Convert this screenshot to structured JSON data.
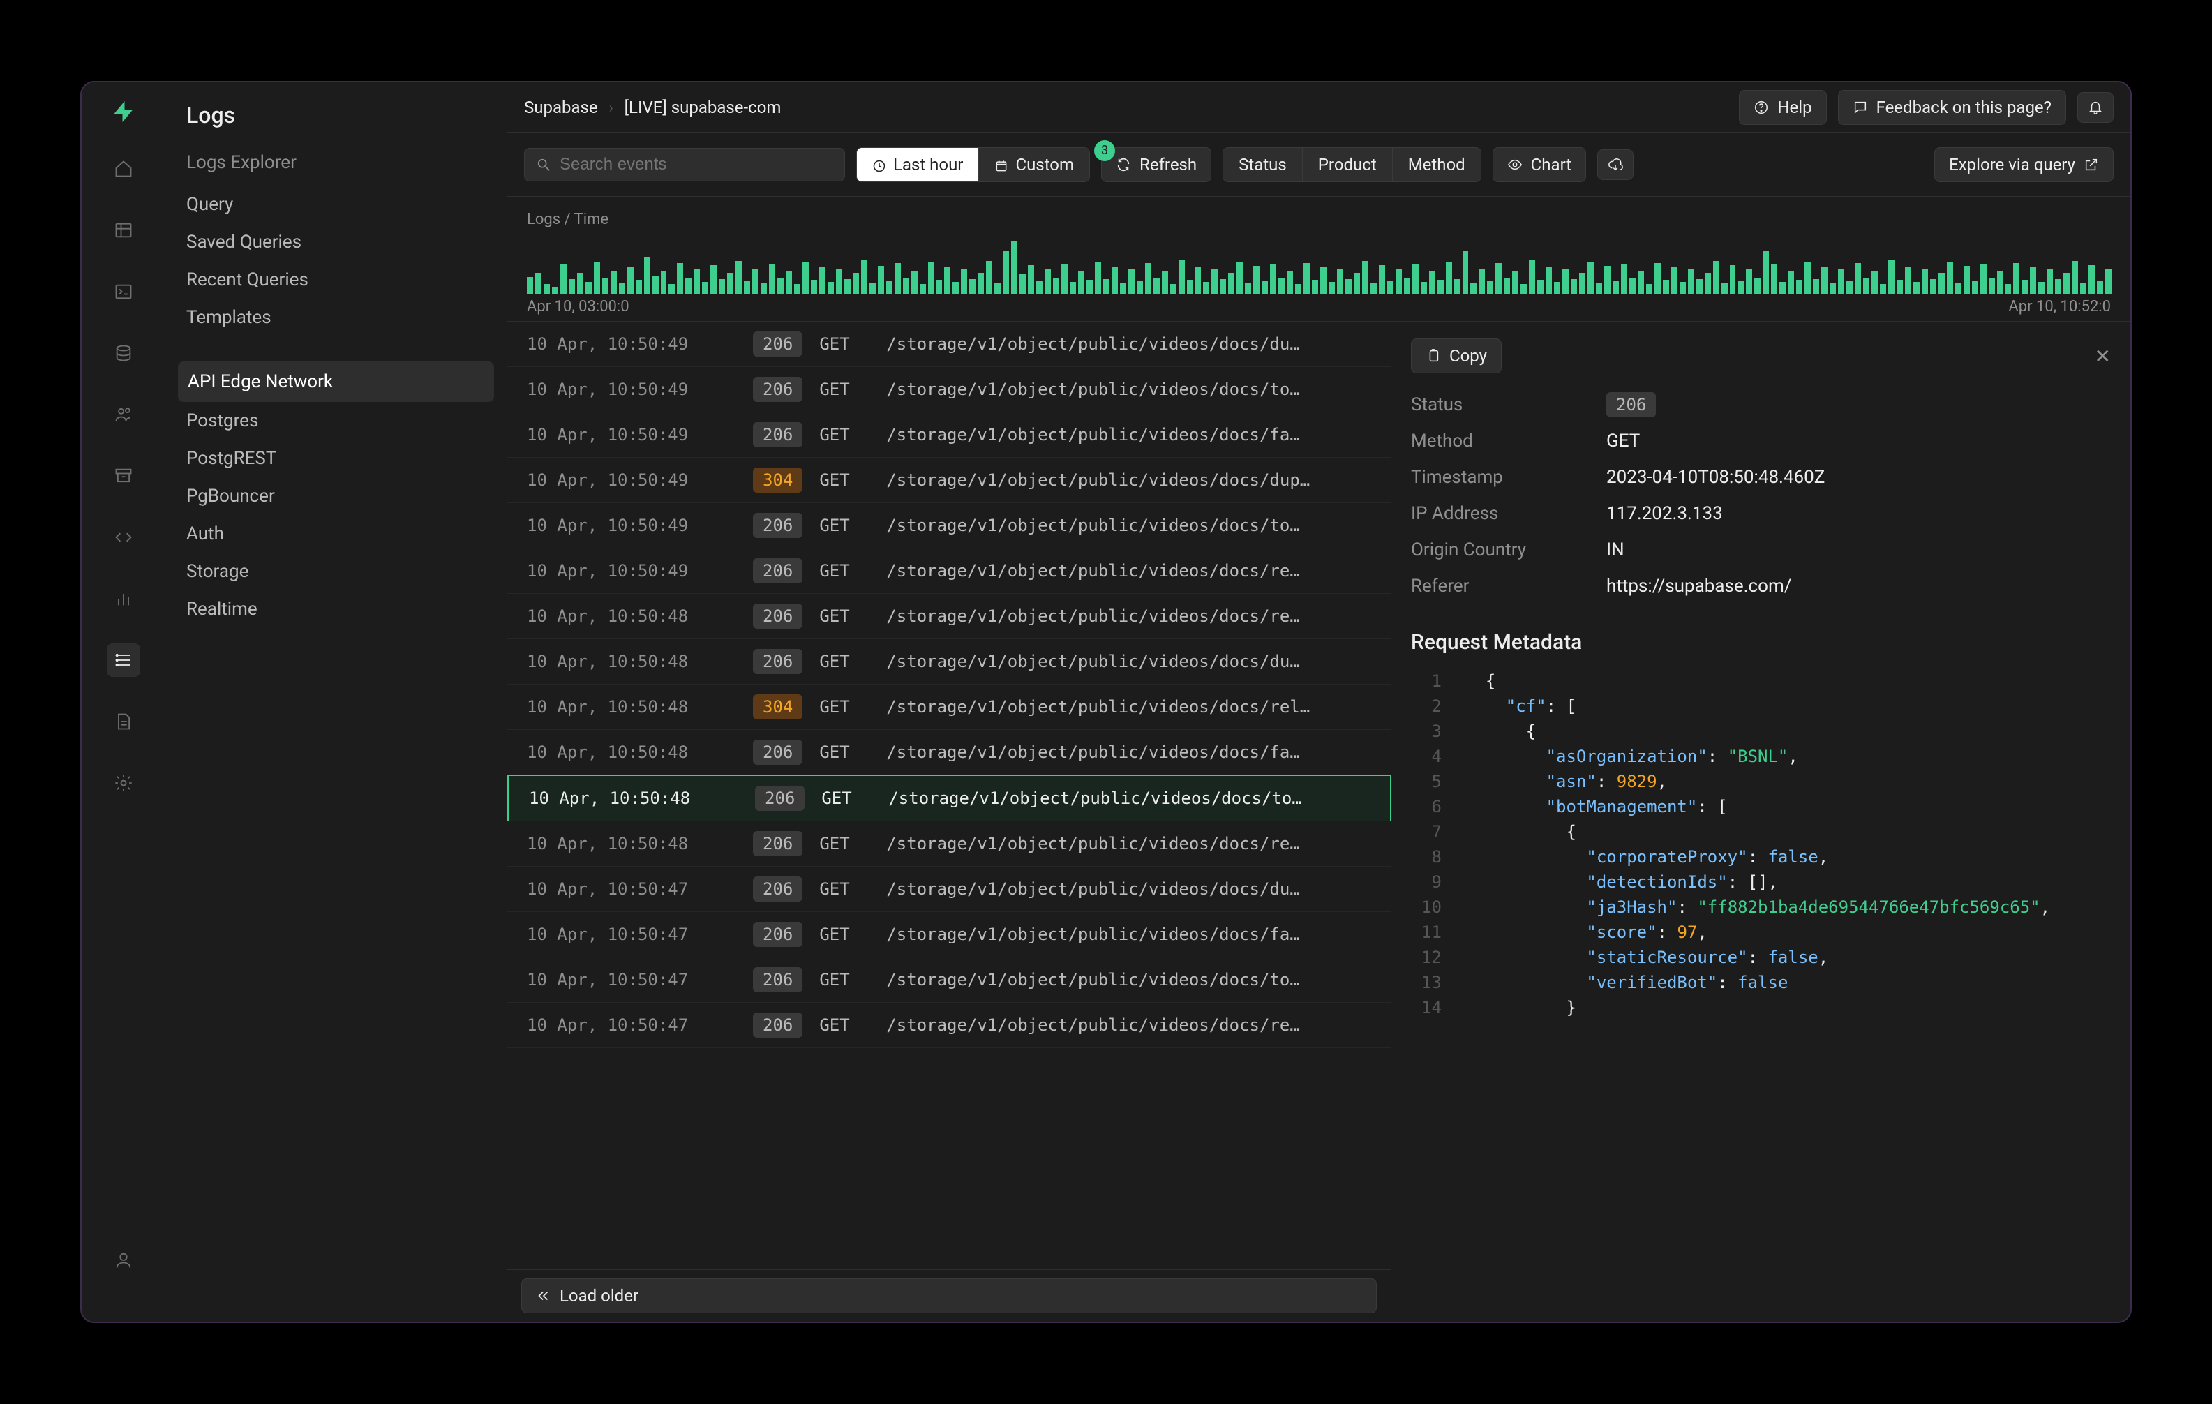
{
  "brand": {
    "accent": "#3ecf8e"
  },
  "topbar": {
    "crumb1": "Supabase",
    "crumb2": "[LIVE] supabase-com",
    "help": "Help",
    "feedback": "Feedback on this page?"
  },
  "subnav": {
    "title": "Logs",
    "section1_label": "Logs Explorer",
    "items1": [
      {
        "label": "Query"
      },
      {
        "label": "Saved Queries"
      },
      {
        "label": "Recent Queries"
      },
      {
        "label": "Templates"
      }
    ],
    "items2": [
      {
        "label": "API Edge Network",
        "active": true
      },
      {
        "label": "Postgres"
      },
      {
        "label": "PostgREST"
      },
      {
        "label": "PgBouncer"
      },
      {
        "label": "Auth"
      },
      {
        "label": "Storage"
      },
      {
        "label": "Realtime"
      }
    ]
  },
  "toolbar": {
    "search_placeholder": "Search events",
    "last_hour": "Last hour",
    "custom": "Custom",
    "refresh": "Refresh",
    "refresh_badge": "3",
    "status": "Status",
    "product": "Product",
    "method": "Method",
    "chart": "Chart",
    "explore": "Explore via query"
  },
  "chart": {
    "label": "Logs / Time",
    "axis_start": "Apr 10, 03:00:0",
    "axis_end": "Apr 10, 10:52:0"
  },
  "chart_data": {
    "type": "bar",
    "title": "Logs / Time",
    "xlabel": "",
    "ylabel": "",
    "categories": [
      "Apr 10, 03:00:0",
      "Apr 10, 10:52:0"
    ],
    "values": [
      32,
      40,
      18,
      12,
      55,
      28,
      40,
      22,
      60,
      30,
      44,
      20,
      50,
      26,
      70,
      34,
      42,
      18,
      58,
      30,
      46,
      22,
      54,
      28,
      40,
      62,
      24,
      48,
      20,
      56,
      30,
      44,
      18,
      60,
      26,
      50,
      22,
      46,
      28,
      40,
      64,
      20,
      52,
      24,
      58,
      30,
      44,
      18,
      60,
      26,
      50,
      22,
      46,
      28,
      40,
      62,
      20,
      80,
      100,
      38,
      54,
      24,
      48,
      30,
      56,
      22,
      44,
      26,
      60,
      28,
      50,
      20,
      46,
      24,
      58,
      30,
      42,
      18,
      64,
      26,
      50,
      22,
      46,
      28,
      40,
      60,
      20,
      52,
      24,
      56,
      30,
      44,
      18,
      58,
      26,
      50,
      22,
      46,
      28,
      40,
      62,
      20,
      54,
      24,
      48,
      30,
      56,
      22,
      44,
      26,
      60,
      28,
      82,
      20,
      46,
      24,
      58,
      30,
      42,
      18,
      64,
      26,
      50,
      22,
      46,
      28,
      40,
      60,
      20,
      52,
      24,
      56,
      30,
      44,
      18,
      58,
      26,
      50,
      22,
      46,
      28,
      40,
      62,
      20,
      54,
      24,
      48,
      30,
      80,
      56,
      22,
      44,
      26,
      60,
      28,
      50,
      20,
      46,
      24,
      58,
      30,
      42,
      18,
      64,
      26,
      50,
      22,
      46,
      28,
      40,
      60,
      20,
      52,
      24,
      56,
      30,
      44,
      18,
      58,
      26,
      50,
      22,
      46,
      28,
      40,
      62,
      20,
      54,
      24,
      48
    ]
  },
  "logs": [
    {
      "ts": "10 Apr, 10:50:49",
      "status": "206",
      "method": "GET",
      "path": "/storage/v1/object/public/videos/docs/du…"
    },
    {
      "ts": "10 Apr, 10:50:49",
      "status": "206",
      "method": "GET",
      "path": "/storage/v1/object/public/videos/docs/to…"
    },
    {
      "ts": "10 Apr, 10:50:49",
      "status": "206",
      "method": "GET",
      "path": "/storage/v1/object/public/videos/docs/fa…"
    },
    {
      "ts": "10 Apr, 10:50:49",
      "status": "304",
      "method": "GET",
      "path": "/storage/v1/object/public/videos/docs/dup…"
    },
    {
      "ts": "10 Apr, 10:50:49",
      "status": "206",
      "method": "GET",
      "path": "/storage/v1/object/public/videos/docs/to…"
    },
    {
      "ts": "10 Apr, 10:50:49",
      "status": "206",
      "method": "GET",
      "path": "/storage/v1/object/public/videos/docs/re…"
    },
    {
      "ts": "10 Apr, 10:50:48",
      "status": "206",
      "method": "GET",
      "path": "/storage/v1/object/public/videos/docs/re…"
    },
    {
      "ts": "10 Apr, 10:50:48",
      "status": "206",
      "method": "GET",
      "path": "/storage/v1/object/public/videos/docs/du…"
    },
    {
      "ts": "10 Apr, 10:50:48",
      "status": "304",
      "method": "GET",
      "path": "/storage/v1/object/public/videos/docs/rel…"
    },
    {
      "ts": "10 Apr, 10:50:48",
      "status": "206",
      "method": "GET",
      "path": "/storage/v1/object/public/videos/docs/fa…"
    },
    {
      "ts": "10 Apr, 10:50:48",
      "status": "206",
      "method": "GET",
      "path": "/storage/v1/object/public/videos/docs/to…",
      "selected": true
    },
    {
      "ts": "10 Apr, 10:50:48",
      "status": "206",
      "method": "GET",
      "path": "/storage/v1/object/public/videos/docs/re…"
    },
    {
      "ts": "10 Apr, 10:50:47",
      "status": "206",
      "method": "GET",
      "path": "/storage/v1/object/public/videos/docs/du…"
    },
    {
      "ts": "10 Apr, 10:50:47",
      "status": "206",
      "method": "GET",
      "path": "/storage/v1/object/public/videos/docs/fa…"
    },
    {
      "ts": "10 Apr, 10:50:47",
      "status": "206",
      "method": "GET",
      "path": "/storage/v1/object/public/videos/docs/to…"
    },
    {
      "ts": "10 Apr, 10:50:47",
      "status": "206",
      "method": "GET",
      "path": "/storage/v1/object/public/videos/docs/re…"
    }
  ],
  "footer": {
    "load_older": "Load older"
  },
  "detail": {
    "copy": "Copy",
    "kvs": {
      "status_k": "Status",
      "status_v": "206",
      "method_k": "Method",
      "method_v": "GET",
      "timestamp_k": "Timestamp",
      "timestamp_v": "2023-04-10T08:50:48.460Z",
      "ip_k": "IP Address",
      "ip_v": "117.202.3.133",
      "country_k": "Origin Country",
      "country_v": "IN",
      "referer_k": "Referer",
      "referer_v": "https://supabase.com/"
    },
    "metadata_title": "Request Metadata",
    "code": [
      {
        "n": 1,
        "indent": 1,
        "tokens": [
          {
            "t": "punc",
            "v": "{"
          }
        ]
      },
      {
        "n": 2,
        "indent": 2,
        "tokens": [
          {
            "t": "key",
            "v": "\"cf\""
          },
          {
            "t": "punc",
            "v": ": ["
          }
        ]
      },
      {
        "n": 3,
        "indent": 3,
        "tokens": [
          {
            "t": "punc",
            "v": "{"
          }
        ]
      },
      {
        "n": 4,
        "indent": 4,
        "tokens": [
          {
            "t": "key",
            "v": "\"asOrganization\""
          },
          {
            "t": "punc",
            "v": ": "
          },
          {
            "t": "str",
            "v": "\"BSNL\""
          },
          {
            "t": "punc",
            "v": ","
          }
        ]
      },
      {
        "n": 5,
        "indent": 4,
        "tokens": [
          {
            "t": "key",
            "v": "\"asn\""
          },
          {
            "t": "punc",
            "v": ": "
          },
          {
            "t": "num",
            "v": "9829"
          },
          {
            "t": "punc",
            "v": ","
          }
        ]
      },
      {
        "n": 6,
        "indent": 4,
        "tokens": [
          {
            "t": "key",
            "v": "\"botManagement\""
          },
          {
            "t": "punc",
            "v": ": ["
          }
        ]
      },
      {
        "n": 7,
        "indent": 5,
        "tokens": [
          {
            "t": "punc",
            "v": "{"
          }
        ]
      },
      {
        "n": 8,
        "indent": 6,
        "tokens": [
          {
            "t": "key",
            "v": "\"corporateProxy\""
          },
          {
            "t": "punc",
            "v": ": "
          },
          {
            "t": "bool",
            "v": "false"
          },
          {
            "t": "punc",
            "v": ","
          }
        ]
      },
      {
        "n": 9,
        "indent": 6,
        "tokens": [
          {
            "t": "key",
            "v": "\"detectionIds\""
          },
          {
            "t": "punc",
            "v": ": [],"
          }
        ]
      },
      {
        "n": 10,
        "indent": 6,
        "tokens": [
          {
            "t": "key",
            "v": "\"ja3Hash\""
          },
          {
            "t": "punc",
            "v": ": "
          },
          {
            "t": "str",
            "v": "\"ff882b1ba4de69544766e47bfc569c65\""
          },
          {
            "t": "punc",
            "v": ","
          }
        ]
      },
      {
        "n": 11,
        "indent": 6,
        "tokens": [
          {
            "t": "key",
            "v": "\"score\""
          },
          {
            "t": "punc",
            "v": ": "
          },
          {
            "t": "num",
            "v": "97"
          },
          {
            "t": "punc",
            "v": ","
          }
        ]
      },
      {
        "n": 12,
        "indent": 6,
        "tokens": [
          {
            "t": "key",
            "v": "\"staticResource\""
          },
          {
            "t": "punc",
            "v": ": "
          },
          {
            "t": "bool",
            "v": "false"
          },
          {
            "t": "punc",
            "v": ","
          }
        ]
      },
      {
        "n": 13,
        "indent": 6,
        "tokens": [
          {
            "t": "key",
            "v": "\"verifiedBot\""
          },
          {
            "t": "punc",
            "v": ": "
          },
          {
            "t": "bool",
            "v": "false"
          }
        ]
      },
      {
        "n": 14,
        "indent": 5,
        "tokens": [
          {
            "t": "punc",
            "v": "}"
          }
        ]
      }
    ]
  }
}
